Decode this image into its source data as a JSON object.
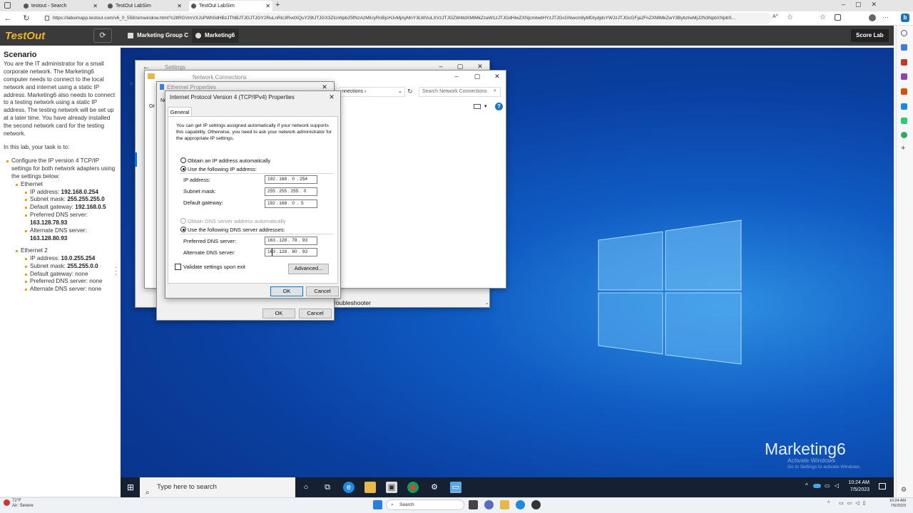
{
  "browser": {
    "tabs": [
      {
        "label": "testout - Search"
      },
      {
        "label": "TestOut LabSim"
      },
      {
        "label": "TestOut LabSim"
      }
    ],
    "url": "https://labsimapp.testout.com/v6_0_558/simwindow.html?c2ltRGVmVXJsPWh0dHBzJTNBJTJGJTJGY2RuLnRlc3RvdXQuY29tJTJGX3ZlcnNpb25fNzAzMiUyRnBjcHJvMjAyMnY3LWVuLXVzJTJGZW4tdXMlMkZzaW1zJTJGdHlwZXNjcmlwdHYzJTJGcGNwcm8yMDIydjdsYWJzJTJGcGFja2FnZXMlMkZwY3BybzIwMjJ2N3NpbXNpbS...",
    "zoom_icon": "A^"
  },
  "testout": {
    "logo": "TestOut",
    "groups": [
      {
        "label": "Marketing Group C"
      },
      {
        "label": "Marketing6"
      }
    ],
    "score_label": "Score Lab"
  },
  "scenario": {
    "heading": "Scenario",
    "intro": "You are the IT administrator for a small corporate network. The Marketing6 computer needs to connect to the local network and internet using a static IP address. Marketing6 also needs to connect to a testing network using a static IP address. The testing network will be set up at a later time. You have already installed the second network card for the testing network.",
    "task_intro": "In this lab, your task is to:",
    "task": "Configure the IP version 4 TCP/IP settings for both network adapters using the settings below:",
    "adapters": [
      {
        "name": "Ethernet",
        "settings": [
          {
            "label": "IP address:",
            "value": "192.168.0.254"
          },
          {
            "label": "Subnet mask:",
            "value": "255.255.255.0"
          },
          {
            "label": "Default gateway:",
            "value": "192.168.0.5"
          },
          {
            "label": "Preferred DNS server:",
            "value": "163.128.78.93"
          },
          {
            "label": "Alternate DNS server:",
            "value": "163.128.80.93"
          }
        ]
      },
      {
        "name": "Ethernet 2",
        "settings": [
          {
            "label": "IP address:",
            "value": "10.0.255.254"
          },
          {
            "label": "Subnet mask:",
            "value": "255.255.0.0"
          },
          {
            "label": "Default gateway:",
            "value": "none"
          },
          {
            "label": "Preferred DNS server:",
            "value": "none"
          },
          {
            "label": "Alternate DNS server:",
            "value": "none"
          }
        ]
      }
    ]
  },
  "settings_window": {
    "title": "Settings"
  },
  "netconn_window": {
    "title": "Network Connections",
    "breadcrumb": "nnections",
    "search_placeholder": "Search Network Connections",
    "troubleshooter": "roubleshooter"
  },
  "eth_props": {
    "title": "Ethernet Properties",
    "ok": "OK",
    "cancel": "Cancel",
    "left_frag1": "Or",
    "left_frag2": "Ne"
  },
  "ipv4": {
    "title": "Internet Protocol Version 4 (TCP/IPv4) Properties",
    "tab": "General",
    "description": "You can get IP settings assigned automatically if your network supports this capability. Otherwise, you need to ask your network administrator for the appropriate IP settings.",
    "auto_ip": "Obtain an IP address automatically",
    "use_ip": "Use the following IP address:",
    "ip_label": "IP address:",
    "ip_value": "192 . 168 .  0  . 254",
    "mask_label": "Subnet mask:",
    "mask_value": "255 . 255 . 255 .  0",
    "gw_label": "Default gateway:",
    "gw_value": "192 . 168 .  0  .  5",
    "auto_dns": "Obtain DNS server address automatically",
    "use_dns": "Use the following DNS server addresses:",
    "pdns_label": "Preferred DNS server:",
    "pdns_value": "163 . 128 .  78 .  93",
    "adns_label": "Alternate DNS server:",
    "adns_value": "163 . 128 .  80 .  93",
    "validate": "Validate settings upon exit",
    "advanced": "Advanced...",
    "ok": "OK",
    "cancel": "Cancel"
  },
  "desktop": {
    "computer_name": "Marketing6",
    "activate_title": "Activate Windows",
    "activate_sub": "Go to Settings to activate Windows."
  },
  "vm_taskbar": {
    "search_placeholder": "Type here to search",
    "time": "10:24 AM",
    "date": "7/5/2023"
  },
  "host_taskbar": {
    "temp": "72°F",
    "condition": "Air: Severe",
    "search": "Search",
    "time": "10:24 AM",
    "date": "7/5/2023"
  },
  "colors": {
    "accent": "#0078d7",
    "testout_yellow": "#f2b61f",
    "testout_bar": "#3a3a3a"
  }
}
